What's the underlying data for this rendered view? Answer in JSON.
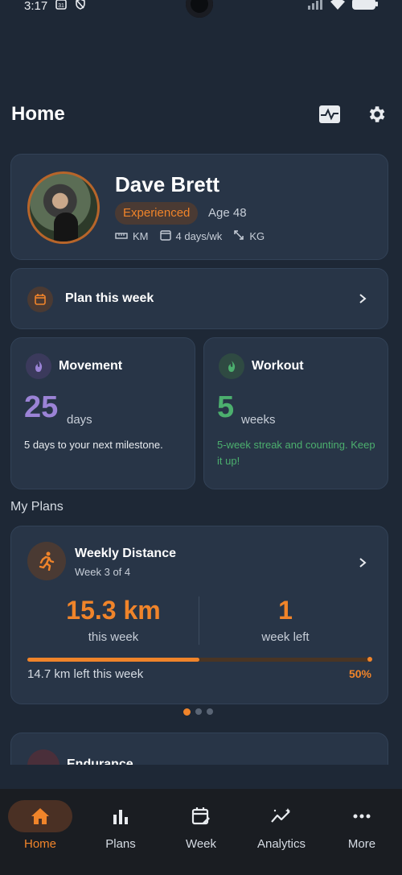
{
  "status": {
    "time": "3:17"
  },
  "header": {
    "title": "Home",
    "activity_icon": "activity-icon",
    "settings_icon": "gear-icon"
  },
  "profile": {
    "name": "Dave Brett",
    "level": "Experienced",
    "age": "Age 48",
    "distance_unit": "KM",
    "frequency": "4 days/wk",
    "weight_unit": "KG"
  },
  "plan_week": {
    "label": "Plan this week"
  },
  "movement": {
    "title": "Movement",
    "value": "25",
    "unit": "days",
    "desc": "5 days to your next milestone."
  },
  "workout": {
    "title": "Workout",
    "value": "5",
    "unit": "weeks",
    "desc": "5-week streak and counting. Keep it up!"
  },
  "my_plans": {
    "label": "My Plans"
  },
  "plan": {
    "title": "Weekly Distance",
    "subtitle": "Week 3 of 4",
    "this_week_value": "15.3 km",
    "this_week_label": "this week",
    "weeks_left_value": "1",
    "weeks_left_label": "week left",
    "remaining": "14.7 km left this week",
    "percent": "50%",
    "progress": 0.5
  },
  "next_plan": {
    "title": "Endurance"
  },
  "nav": {
    "home": "Home",
    "plans": "Plans",
    "week": "Week",
    "analytics": "Analytics",
    "more": "More"
  },
  "colors": {
    "accent": "#f0842a",
    "movement": "#9b83d6",
    "workout": "#4caf6e",
    "background": "#1e2836",
    "card": "#283547"
  }
}
